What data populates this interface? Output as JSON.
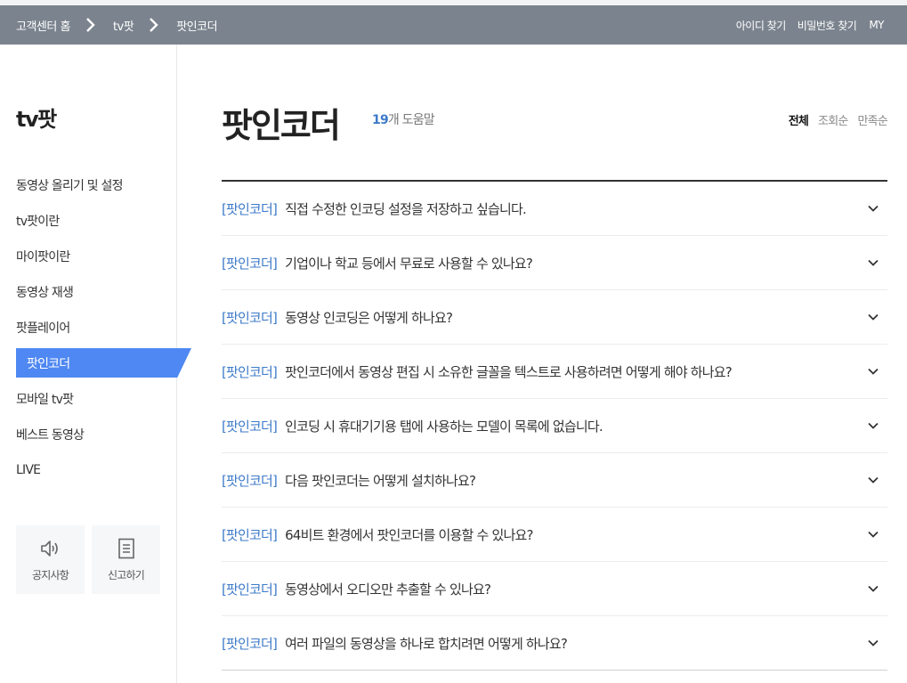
{
  "header": {
    "breadcrumbs": [
      "고객센터 홈",
      "tv팟",
      "팟인코더"
    ],
    "links": [
      "아이디 찾기",
      "비밀번호 찾기",
      "MY"
    ]
  },
  "sidebar": {
    "title": "tv팟",
    "items": [
      {
        "label": "동영상 올리기 및 설정"
      },
      {
        "label": "tv팟이란"
      },
      {
        "label": "마이팟이란"
      },
      {
        "label": "동영상 재생"
      },
      {
        "label": "팟플레이어"
      },
      {
        "label": "팟인코더",
        "active": true
      },
      {
        "label": "모바일 tv팟"
      },
      {
        "label": "베스트 동영상"
      },
      {
        "label": "LIVE"
      }
    ],
    "quick": [
      {
        "label": "공지사항",
        "icon": "speaker-icon"
      },
      {
        "label": "신고하기",
        "icon": "document-icon"
      }
    ]
  },
  "main": {
    "title": "팟인코더",
    "count_num": "19",
    "count_suffix": "개 도움말",
    "sorts": [
      "전체",
      "조회순",
      "만족순"
    ],
    "faq": [
      {
        "category": "[팟인코더]",
        "question": "직접 수정한 인코딩 설정을 저장하고 싶습니다."
      },
      {
        "category": "[팟인코더]",
        "question": "기업이나 학교 등에서 무료로 사용할 수 있나요?"
      },
      {
        "category": "[팟인코더]",
        "question": "동영상 인코딩은 어떻게 하나요?"
      },
      {
        "category": "[팟인코더]",
        "question": "팟인코더에서 동영상 편집 시 소유한 글꼴을 텍스트로 사용하려면 어떻게 해야 하나요?"
      },
      {
        "category": "[팟인코더]",
        "question": "인코딩 시 휴대기기용 탭에 사용하는 모델이 목록에 없습니다."
      },
      {
        "category": "[팟인코더]",
        "question": "다음 팟인코더는 어떻게 설치하나요?"
      },
      {
        "category": "[팟인코더]",
        "question": "64비트 환경에서 팟인코더를 이용할 수 있나요?"
      },
      {
        "category": "[팟인코더]",
        "question": "동영상에서 오디오만 추출할 수 있나요?"
      },
      {
        "category": "[팟인코더]",
        "question": "여러 파일의 동영상을 하나로 합치려면 어떻게 하나요?"
      }
    ]
  }
}
